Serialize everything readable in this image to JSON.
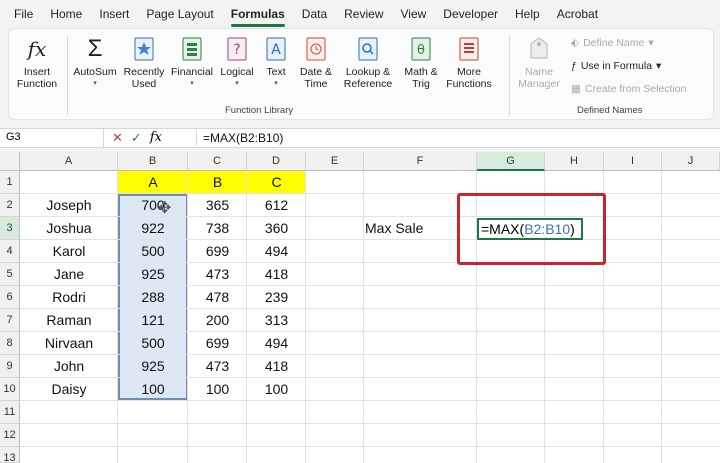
{
  "menu": {
    "tabs": [
      "File",
      "Home",
      "Insert",
      "Page Layout",
      "Formulas",
      "Data",
      "Review",
      "View",
      "Developer",
      "Help",
      "Acrobat"
    ],
    "active": "Formulas"
  },
  "ribbon": {
    "insert_function": {
      "line1": "Insert",
      "line2": "Function"
    },
    "autosum": "AutoSum",
    "recently_used": {
      "line1": "Recently",
      "line2": "Used"
    },
    "financial": "Financial",
    "logical": "Logical",
    "text": "Text",
    "date_time": {
      "line1": "Date &",
      "line2": "Time"
    },
    "lookup": {
      "line1": "Lookup &",
      "line2": "Reference"
    },
    "math": {
      "line1": "Math &",
      "line2": "Trig"
    },
    "more": {
      "line1": "More",
      "line2": "Functions"
    },
    "function_library_label": "Function Library",
    "name_manager": {
      "line1": "Name",
      "line2": "Manager"
    },
    "define_name": "Define Name",
    "use_in_formula": "Use in Formula",
    "create_from_selection": "Create from Selection",
    "defined_names_label": "Defined Names"
  },
  "formula_bar": {
    "name_box": "G3",
    "cancel_symbol": "✕",
    "enter_symbol": "✓",
    "fx_symbol": "fx",
    "formula": "=MAX(B2:B10)"
  },
  "columns": [
    "A",
    "B",
    "C",
    "D",
    "E",
    "F",
    "G",
    "H",
    "I",
    "J"
  ],
  "rows": [
    "1",
    "2",
    "3",
    "4",
    "5",
    "6",
    "7",
    "8",
    "9",
    "10",
    "11",
    "12",
    "13"
  ],
  "sheet": {
    "header_row": [
      "A",
      "B",
      "C"
    ],
    "data": [
      {
        "name": "Joseph",
        "b": "700",
        "c": "365",
        "d": "612"
      },
      {
        "name": "Joshua",
        "b": "922",
        "c": "738",
        "d": "360"
      },
      {
        "name": "Karol",
        "b": "500",
        "c": "699",
        "d": "494"
      },
      {
        "name": "Jane",
        "b": "925",
        "c": "473",
        "d": "418"
      },
      {
        "name": "Rodri",
        "b": "288",
        "c": "478",
        "d": "239"
      },
      {
        "name": "Raman",
        "b": "121",
        "c": "200",
        "d": "313"
      },
      {
        "name": "Nirvaan",
        "b": "500",
        "c": "699",
        "d": "494"
      },
      {
        "name": "John",
        "b": "925",
        "c": "473",
        "d": "418"
      },
      {
        "name": "Daisy",
        "b": "100",
        "c": "100",
        "d": "100"
      }
    ],
    "max_label": "Max Sale",
    "g3_prefix": "=MAX(",
    "g3_ref": "B2:B10",
    "g3_suffix": ")"
  },
  "colors": {
    "accent": "#1b7a43",
    "header_highlight": "#fffe00",
    "selection_fill": "#dde8f4",
    "annotation_box": "#c6242f"
  }
}
